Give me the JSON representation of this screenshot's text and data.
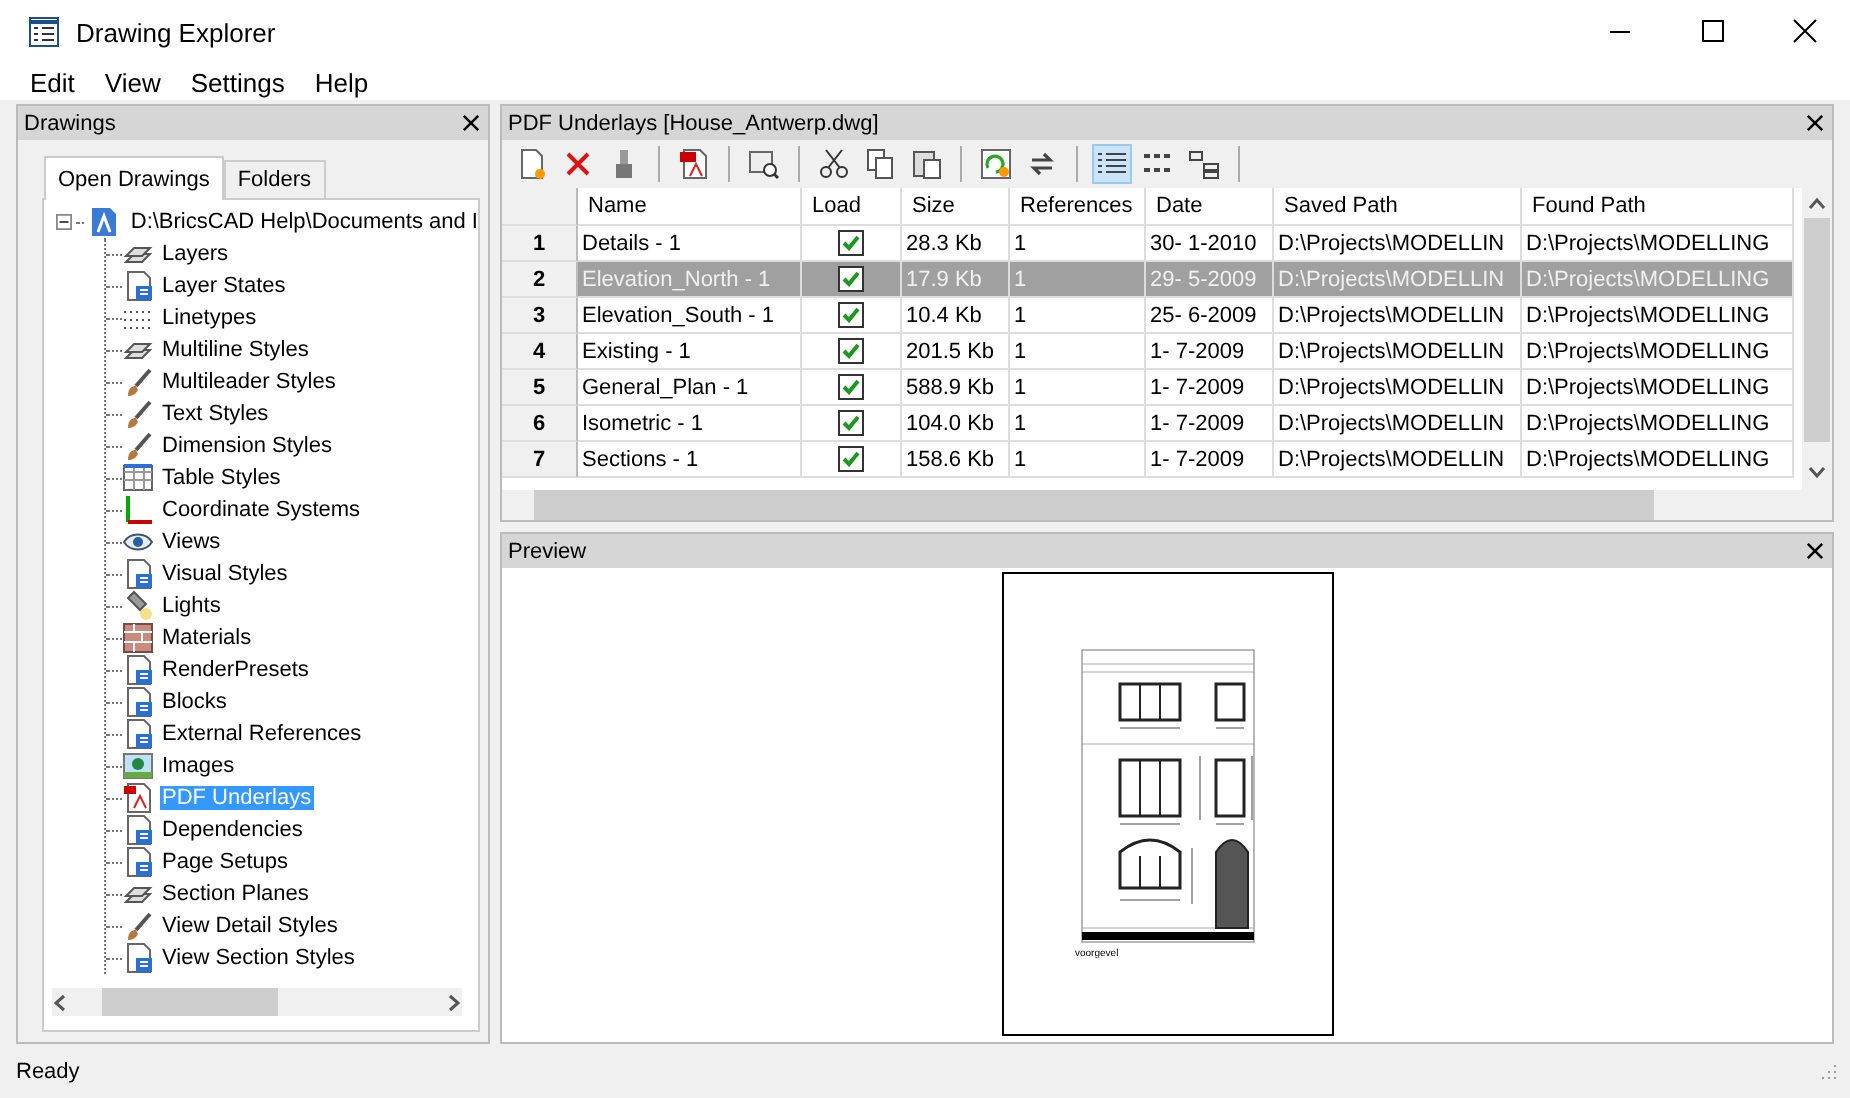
{
  "window": {
    "title": "Drawing Explorer"
  },
  "menu": [
    "Edit",
    "View",
    "Settings",
    "Help"
  ],
  "drawings_panel": {
    "title": "Drawings",
    "tabs": [
      {
        "label": "Open Drawings",
        "selected": true
      },
      {
        "label": "Folders",
        "selected": false
      }
    ],
    "tree": {
      "label": "D:\\BricsCAD Help\\Documents and I",
      "expanded": true,
      "children": [
        {
          "label": "Layers",
          "selected": false
        },
        {
          "label": "Layer States",
          "selected": false
        },
        {
          "label": "Linetypes",
          "selected": false
        },
        {
          "label": "Multiline Styles",
          "selected": false
        },
        {
          "label": "Multileader Styles",
          "selected": false
        },
        {
          "label": "Text Styles",
          "selected": false
        },
        {
          "label": "Dimension Styles",
          "selected": false
        },
        {
          "label": "Table Styles",
          "selected": false
        },
        {
          "label": "Coordinate Systems",
          "selected": false
        },
        {
          "label": "Views",
          "selected": false
        },
        {
          "label": "Visual Styles",
          "selected": false
        },
        {
          "label": "Lights",
          "selected": false
        },
        {
          "label": "Materials",
          "selected": false
        },
        {
          "label": "RenderPresets",
          "selected": false
        },
        {
          "label": "Blocks",
          "selected": false
        },
        {
          "label": "External References",
          "selected": false
        },
        {
          "label": "Images",
          "selected": false
        },
        {
          "label": "PDF Underlays",
          "selected": true
        },
        {
          "label": "Dependencies",
          "selected": false
        },
        {
          "label": "Page Setups",
          "selected": false
        },
        {
          "label": "Section Planes",
          "selected": false
        },
        {
          "label": "View Detail Styles",
          "selected": false
        },
        {
          "label": "View Section Styles",
          "selected": false
        }
      ]
    }
  },
  "underlays_panel": {
    "title": "PDF Underlays [House_Antwerp.dwg]",
    "view_modes": [
      {
        "selected": true
      },
      {
        "selected": false
      },
      {
        "selected": false
      }
    ],
    "table": {
      "columns": [
        "Name",
        "Load",
        "Size",
        "References",
        "Date",
        "Saved Path",
        "Found Path"
      ],
      "rows": [
        {
          "number": "1",
          "name": "Details - 1",
          "load": true,
          "size": "28.3 Kb",
          "references": "1",
          "date": "30- 1-2010",
          "saved_path": "D:\\Projects\\MODELLIN",
          "found_path": "D:\\Projects\\MODELLING",
          "selected": false
        },
        {
          "number": "2",
          "name": "Elevation_North - 1",
          "load": true,
          "size": "17.9 Kb",
          "references": "1",
          "date": "29- 5-2009",
          "saved_path": "D:\\Projects\\MODELLIN",
          "found_path": "D:\\Projects\\MODELLING",
          "selected": true
        },
        {
          "number": "3",
          "name": "Elevation_South - 1",
          "load": true,
          "size": "10.4 Kb",
          "references": "1",
          "date": "25- 6-2009",
          "saved_path": "D:\\Projects\\MODELLIN",
          "found_path": "D:\\Projects\\MODELLING",
          "selected": false
        },
        {
          "number": "4",
          "name": "Existing - 1",
          "load": true,
          "size": "201.5 Kb",
          "references": "1",
          "date": "1- 7-2009",
          "saved_path": "D:\\Projects\\MODELLIN",
          "found_path": "D:\\Projects\\MODELLING",
          "selected": false
        },
        {
          "number": "5",
          "name": "General_Plan - 1",
          "load": true,
          "size": "588.9 Kb",
          "references": "1",
          "date": "1- 7-2009",
          "saved_path": "D:\\Projects\\MODELLIN",
          "found_path": "D:\\Projects\\MODELLING",
          "selected": false
        },
        {
          "number": "6",
          "name": "Isometric - 1",
          "load": true,
          "size": "104.0 Kb",
          "references": "1",
          "date": "1- 7-2009",
          "saved_path": "D:\\Projects\\MODELLIN",
          "found_path": "D:\\Projects\\MODELLING",
          "selected": false
        },
        {
          "number": "7",
          "name": "Sections - 1",
          "load": true,
          "size": "158.6 Kb",
          "references": "1",
          "date": "1- 7-2009",
          "saved_path": "D:\\Projects\\MODELLIN",
          "found_path": "D:\\Projects\\MODELLING",
          "selected": false
        }
      ]
    }
  },
  "preview_panel": {
    "title": "Preview",
    "caption": "voorgevel"
  },
  "status_bar": {
    "text": "Ready"
  }
}
